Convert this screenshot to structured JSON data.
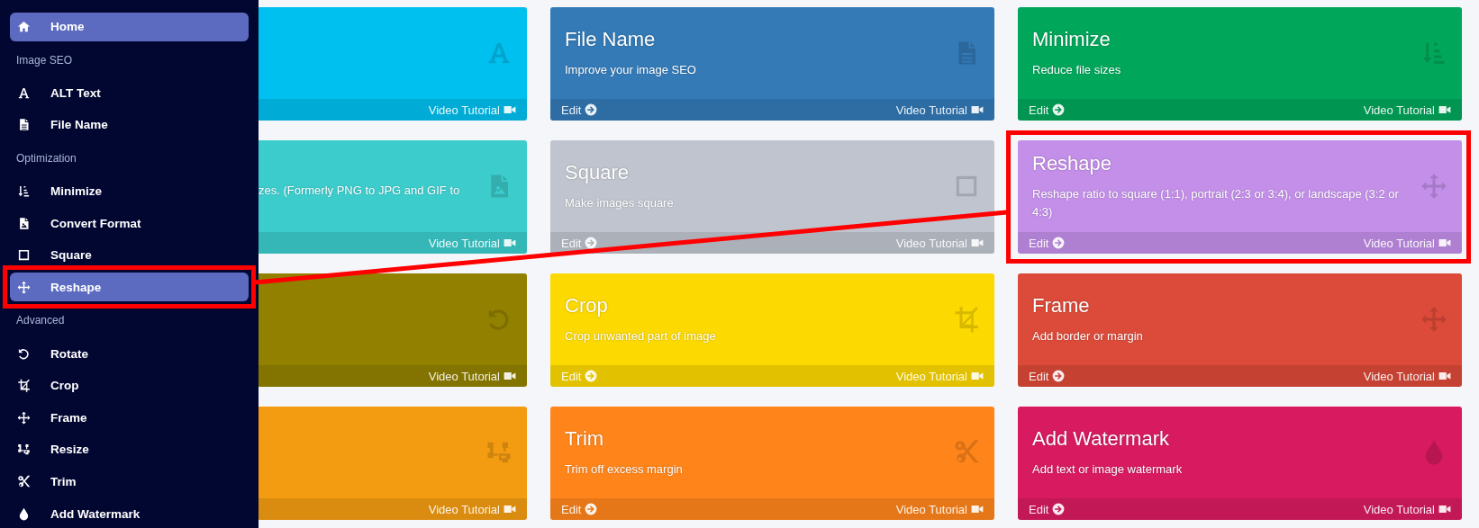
{
  "sidebar": {
    "items": [
      {
        "kind": "home",
        "label": "Home",
        "selected": true,
        "highlighted": false
      },
      {
        "kind": "heading",
        "label": "Image SEO"
      },
      {
        "kind": "alt",
        "label": "ALT Text",
        "selected": false,
        "highlighted": false
      },
      {
        "kind": "file",
        "label": "File Name",
        "selected": false,
        "highlighted": false
      },
      {
        "kind": "heading",
        "label": "Optimization"
      },
      {
        "kind": "sort",
        "label": "Minimize",
        "selected": false,
        "highlighted": false
      },
      {
        "kind": "image-file",
        "label": "Convert Format",
        "selected": false,
        "highlighted": false
      },
      {
        "kind": "square",
        "label": "Square",
        "selected": false,
        "highlighted": false
      },
      {
        "kind": "move",
        "label": "Reshape",
        "selected": true,
        "highlighted": true
      },
      {
        "kind": "heading",
        "label": "Advanced"
      },
      {
        "kind": "rotate",
        "label": "Rotate",
        "selected": false,
        "highlighted": false
      },
      {
        "kind": "crop",
        "label": "Crop",
        "selected": false,
        "highlighted": false
      },
      {
        "kind": "move",
        "label": "Frame",
        "selected": false,
        "highlighted": false
      },
      {
        "kind": "resize",
        "label": "Resize",
        "selected": false,
        "highlighted": false
      },
      {
        "kind": "scissors",
        "label": "Trim",
        "selected": false,
        "highlighted": false
      },
      {
        "kind": "droplet",
        "label": "Add Watermark",
        "selected": false,
        "highlighted": false
      }
    ]
  },
  "cards": [
    {
      "kind": "alt",
      "color": "#00c0ef",
      "video_label": "Video Tutorial",
      "highlighted": false
    },
    {
      "kind": "file",
      "title": "File Name",
      "description": "Improve your image SEO",
      "color": "#337ab7",
      "edit_label": "Edit",
      "video_label": "Video Tutorial",
      "highlighted": false
    },
    {
      "kind": "sort",
      "title": "Minimize",
      "description": "Reduce file sizes",
      "color": "#00a65a",
      "edit_label": "Edit",
      "video_label": "Video Tutorial",
      "highlighted": false
    },
    {
      "kind": "image-file",
      "description": "zes. (Formerly PNG to JPG and GIF to",
      "color": "#3dcccc",
      "video_label": "Video Tutorial",
      "highlighted": false
    },
    {
      "kind": "square",
      "title": "Square",
      "description": "Make images square",
      "color": "#bfc4ce",
      "edit_label": "Edit",
      "video_label": "Video Tutorial",
      "highlighted": false
    },
    {
      "kind": "move",
      "title": "Reshape",
      "description": "Reshape ratio to square (1:1), portrait (2:3 or 3:4), or landscape (3:2 or 4:3)",
      "color": "#c38fe9",
      "edit_label": "Edit",
      "video_label": "Video Tutorial",
      "highlighted": true
    },
    {
      "kind": "rotate",
      "color": "#928100",
      "video_label": "Video Tutorial",
      "highlighted": false
    },
    {
      "kind": "crop",
      "title": "Crop",
      "description": "Crop unwanted part of image",
      "color": "#fcd900",
      "edit_label": "Edit",
      "video_label": "Video Tutorial",
      "highlighted": false
    },
    {
      "kind": "move",
      "title": "Frame",
      "description": "Add border or margin",
      "color": "#dc4a39",
      "edit_label": "Edit",
      "video_label": "Video Tutorial",
      "highlighted": false
    },
    {
      "kind": "resize",
      "color": "#f39c12",
      "video_label": "Video Tutorial",
      "highlighted": false
    },
    {
      "kind": "scissors",
      "title": "Trim",
      "description": "Trim off excess margin",
      "color": "#ff851b",
      "edit_label": "Edit",
      "video_label": "Video Tutorial",
      "highlighted": false
    },
    {
      "kind": "droplet",
      "title": "Add Watermark",
      "description": "Add text or image watermark",
      "color": "#d81b60",
      "edit_label": "Edit",
      "video_label": "Video Tutorial",
      "highlighted": false
    }
  ],
  "annotation": {
    "kind": "connector"
  }
}
